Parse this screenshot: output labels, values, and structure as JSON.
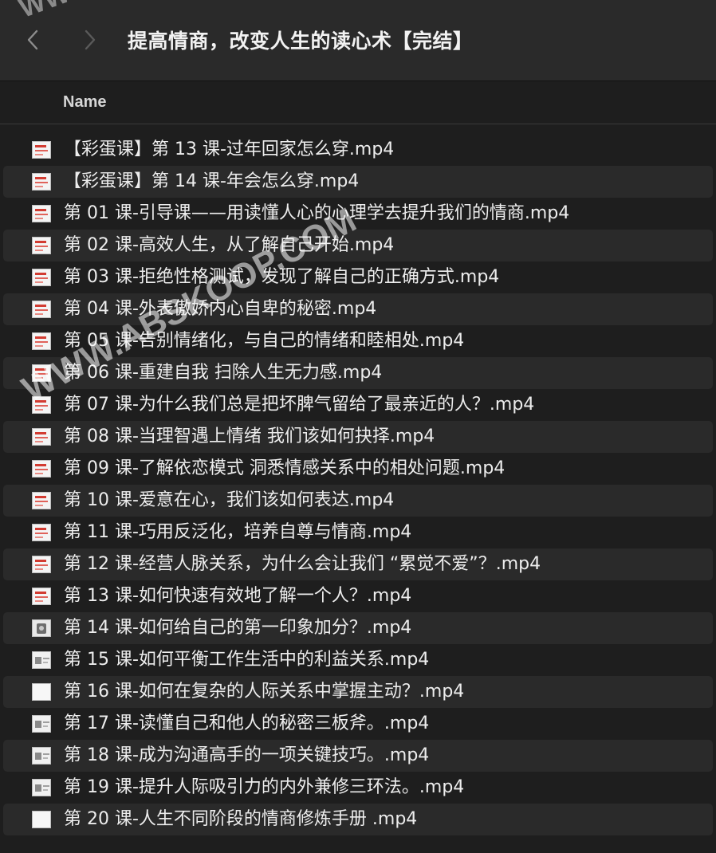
{
  "window": {
    "title": "提高情商，改变人生的读心术【完结】",
    "back_icon": "chevron-left-icon",
    "forward_icon": "chevron-right-icon"
  },
  "columns": {
    "name": "Name"
  },
  "files": [
    {
      "name": "【彩蛋课】第 13 课-过年回家怎么穿.mp4",
      "icon": "video-thumb-red"
    },
    {
      "name": "【彩蛋课】第 14 课-年会怎么穿.mp4",
      "icon": "video-thumb-red"
    },
    {
      "name": "第 01 课-引导课——用读懂人心的心理学去提升我们的情商.mp4",
      "icon": "video-thumb-red"
    },
    {
      "name": "第 02 课-高效人生，从了解自己开始.mp4",
      "icon": "video-thumb-red"
    },
    {
      "name": "第 03 课-拒绝性格测试，发现了解自己的正确方式.mp4",
      "icon": "video-thumb-red"
    },
    {
      "name": "第 04 课-外表傲娇内心自卑的秘密.mp4",
      "icon": "video-thumb-red"
    },
    {
      "name": "第 05 课-告别情绪化，与自己的情绪和睦相处.mp4",
      "icon": "video-thumb-red"
    },
    {
      "name": "第 06 课-重建自我 扫除人生无力感.mp4",
      "icon": "video-thumb-red"
    },
    {
      "name": "第 07 课-为什么我们总是把坏脾气留给了最亲近的人？.mp4",
      "icon": "video-thumb-red"
    },
    {
      "name": "第 08 课-当理智遇上情绪 我们该如何抉择.mp4",
      "icon": "video-thumb-red"
    },
    {
      "name": "第 09 课-了解依恋模式 洞悉情感关系中的相处问题.mp4",
      "icon": "video-thumb-red"
    },
    {
      "name": "第 10 课-爱意在心，我们该如何表达.mp4",
      "icon": "video-thumb-red"
    },
    {
      "name": "第 11 课-巧用反泛化，培养自尊与情商.mp4",
      "icon": "video-thumb-red"
    },
    {
      "name": "第 12 课-经营人脉关系，为什么会让我们 “累觉不爱”？.mp4",
      "icon": "video-thumb-red"
    },
    {
      "name": "第 13 课-如何快速有效地了解一个人？.mp4",
      "icon": "video-thumb-red"
    },
    {
      "name": "第 14 课-如何给自己的第一印象加分？.mp4",
      "icon": "video-thumb-photo"
    },
    {
      "name": "第 15 课-如何平衡工作生活中的利益关系.mp4",
      "icon": "video-thumb-slide"
    },
    {
      "name": "第 16 课-如何在复杂的人际关系中掌握主动？.mp4",
      "icon": "video-thumb-blank"
    },
    {
      "name": "第 17 课-读懂自己和他人的秘密三板斧。.mp4",
      "icon": "video-thumb-slide"
    },
    {
      "name": "第 18 课-成为沟通高手的一项关键技巧。.mp4",
      "icon": "video-thumb-slide"
    },
    {
      "name": "第 19 课-提升人际吸引力的内外兼修三环法。.mp4",
      "icon": "video-thumb-slide"
    },
    {
      "name": "第 20 课-人生不同阶段的情商修炼手册 .mp4",
      "icon": "video-thumb-blank"
    }
  ],
  "watermark": {
    "top": "WW",
    "middle": "WWW.ABSKOOP.COM"
  },
  "colors": {
    "background": "#1e1e1e",
    "toolbar": "#2a2a2a",
    "row_alt": "#2a2a2a",
    "text": "#ededed",
    "icon_accent": "#d23c32"
  }
}
